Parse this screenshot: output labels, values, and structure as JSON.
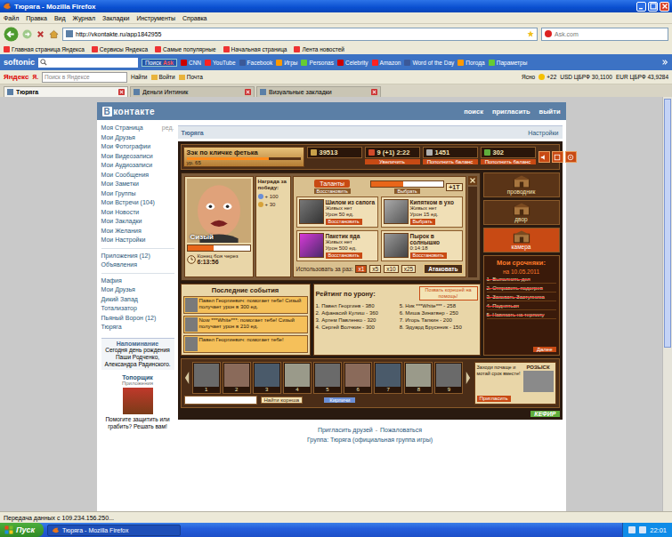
{
  "window": {
    "title": "Тюряга - Mozilla Firefox"
  },
  "menu": [
    "Файл",
    "Правка",
    "Вид",
    "Журнал",
    "Закладки",
    "Инструменты",
    "Справка"
  ],
  "nav": {
    "url": "http://vkontakte.ru/app1842955",
    "search_placeholder": "Ask.com"
  },
  "bookmarks": [
    "Главная страница Яндекса",
    "Сервисы Яндекса",
    "Самые популярные",
    "Начальная страница",
    "Лента новостей"
  ],
  "softonic": {
    "logo": "softonic",
    "search_button": "Поиск",
    "engine": "Ask",
    "links": [
      "CNN",
      "YouTube",
      "Facebook",
      "Игры",
      "Personas",
      "Celebrity",
      "Amazon",
      "Word of the Day",
      "Погода",
      "Параметры"
    ]
  },
  "yandex": {
    "logo": "Яндекс",
    "ya": "Я.",
    "placeholder": "Поиск в Яндексе",
    "find": "Найти",
    "items": [
      "Войти",
      "Почта"
    ],
    "weather": "Ясно",
    "temp": "+22",
    "rates": [
      "USD ЦБРФ 30,1100",
      "EUR ЦБРФ 43,9284"
    ]
  },
  "tabs": [
    {
      "label": "Тюряга",
      "selected": true
    },
    {
      "label": "Деньги Интиник",
      "selected": false
    },
    {
      "label": "Визуальные закладки",
      "selected": false
    }
  ],
  "vk": {
    "logo_letter": "В",
    "logo_text": "контакте",
    "nav": [
      "поиск",
      "пригласить",
      "выйти"
    ],
    "sidebar": {
      "items": [
        {
          "label": "Моя Страница",
          "edit": "ред."
        },
        {
          "label": "Мои Друзья"
        },
        {
          "label": "Мои Фотографии"
        },
        {
          "label": "Мои Видеозаписи"
        },
        {
          "label": "Мои Аудиозаписи"
        },
        {
          "label": "Мои Сообщения"
        },
        {
          "label": "Мои Заметки"
        },
        {
          "label": "Мои Группы"
        },
        {
          "label": "Мои Встречи (104)"
        },
        {
          "label": "Мои Новости"
        },
        {
          "label": "Мои Закладки"
        },
        {
          "label": "Мои Желания"
        },
        {
          "label": "Мои Настройки"
        }
      ],
      "apps_header": [
        "Приложения (12)",
        "Объявления"
      ],
      "apps": [
        "Мафия",
        "Мои Друзья",
        "Дикий Запад",
        "Тотализатор",
        "Пьяный Ворон (12)",
        "Тюряга"
      ],
      "reminder": {
        "title": "Напоминание",
        "text": "Сегодня день рождения Паши Родченко, Александра Радинского."
      },
      "ad": {
        "title": "Топорщик",
        "subtitle": "Приложения",
        "text": "Помогите защитить или грабить? Решать вам!"
      }
    },
    "footer": {
      "links": [
        "Пригласить друзей",
        "Пожаловаться"
      ],
      "separator": "-",
      "group": "Группа: Тюряга (официальная группа игры)"
    }
  },
  "game": {
    "title": "Тюряга",
    "settings": "Настройки",
    "player": {
      "name": "Зэк по кличке фетька",
      "level_text": "ур. 65",
      "level": 0.72
    },
    "stats": [
      {
        "value": "39513",
        "button": "",
        "color": "#c9a24a"
      },
      {
        "value": "9 (+1) 2:22",
        "button": "Увеличить",
        "color": "#d04a2a"
      },
      {
        "value": "1451",
        "button": "Пополнить баланс",
        "color": "#b0b0b0"
      },
      {
        "value": "302",
        "button": "Пополнить баланс",
        "color": "#5fae3c"
      }
    ],
    "boss": {
      "name": "Сизый",
      "level": 0.42,
      "reward_title": "Награда за победу:",
      "rewards": [
        "+ 100",
        "+ 30"
      ],
      "timer_label": "Конец боя через",
      "timer": "6:13:56"
    },
    "talents": {
      "label": "Таланты",
      "restore": "Восстановить",
      "choose": "Выбрать",
      "bonus": "+1Т",
      "level": 0.45
    },
    "weapons": [
      {
        "name": "Шилом из сапога",
        "stats": [
          "Живых нет",
          "Урон 50 ед."
        ],
        "button": "Восстановить"
      },
      {
        "name": "Кипятком в ухо",
        "stats": [
          "Живых нет",
          "Урон 15 ед."
        ],
        "button": "Выбрать"
      },
      {
        "name": "Пакетик яда",
        "stats": [
          "Живых нет",
          "Урон 500 ед."
        ],
        "button": "Восстановить"
      },
      {
        "name": "Пырок в солнышко",
        "stats": [
          "0:14:18"
        ],
        "button": "Восстановить"
      }
    ],
    "multiplier": {
      "label": "Использовать за раз:",
      "options": [
        {
          "label": "x1",
          "selected": true
        },
        {
          "label": "x5",
          "selected": false
        },
        {
          "label": "x10",
          "selected": false
        },
        {
          "label": "x25",
          "selected": false
        }
      ],
      "attack": "Атаковать"
    },
    "events": {
      "title": "Последние события",
      "items": [
        {
          "text": "Павел Георгиевич: помогает тебе! Сизый получает урон в 300 ед."
        },
        {
          "text": "Now ***White***: помогает тебе! Сизый получает урон в 210 ед."
        },
        {
          "text": "Павел Георгиевич: помогает тебе!"
        }
      ]
    },
    "call_help": "Позвать корешей на помощь!",
    "rating": {
      "title": "Рейтинг по урону:",
      "rows": [
        "1. Павел Георгиев - 380",
        "2. Афанасий Кулиш - 360",
        "3. Артем Павленко - 320",
        "4. Сергей Волчкин - 300",
        "5. Ник ***White*** - 258",
        "6. Миша Зинатвер - 250",
        "7. Игорь Тапкин - 200",
        "8. Эдуард Брусеник - 150"
      ]
    },
    "locations": [
      {
        "label": "проводник",
        "selected": false
      },
      {
        "label": "двор",
        "selected": false
      },
      {
        "label": "камера",
        "selected": true
      }
    ],
    "tasks": {
      "title": "Мои срочняки:",
      "date": "на 10.05.2011",
      "items": [
        {
          "label": "1. Выполнить дел",
          "done": true
        },
        {
          "label": "2. Отправить подогрев",
          "done": true
        },
        {
          "label": "3. Заковать Заступника",
          "done": true
        },
        {
          "label": "4. Подняться",
          "done": true
        },
        {
          "label": "5. Навязать на терпилу",
          "done": true
        }
      ],
      "more": "Далее"
    },
    "friends": {
      "slots": [
        "1",
        "2",
        "3",
        "4",
        "5",
        "6",
        "7",
        "8",
        "9"
      ],
      "find_button": "Найти кореша",
      "tab": "Кирпичи"
    },
    "wanted": {
      "title": "РОЗЫСК",
      "text": "Заходи почаще и мотай срок вместе!",
      "button": "Пригласить"
    },
    "kefir": "КЕФИР"
  },
  "status_bar": "Передача данных с 109.234.156.250...",
  "taskbar": {
    "start": "Пуск",
    "window": "Тюряга - Mozilla Firefox",
    "clock": "22:01"
  }
}
